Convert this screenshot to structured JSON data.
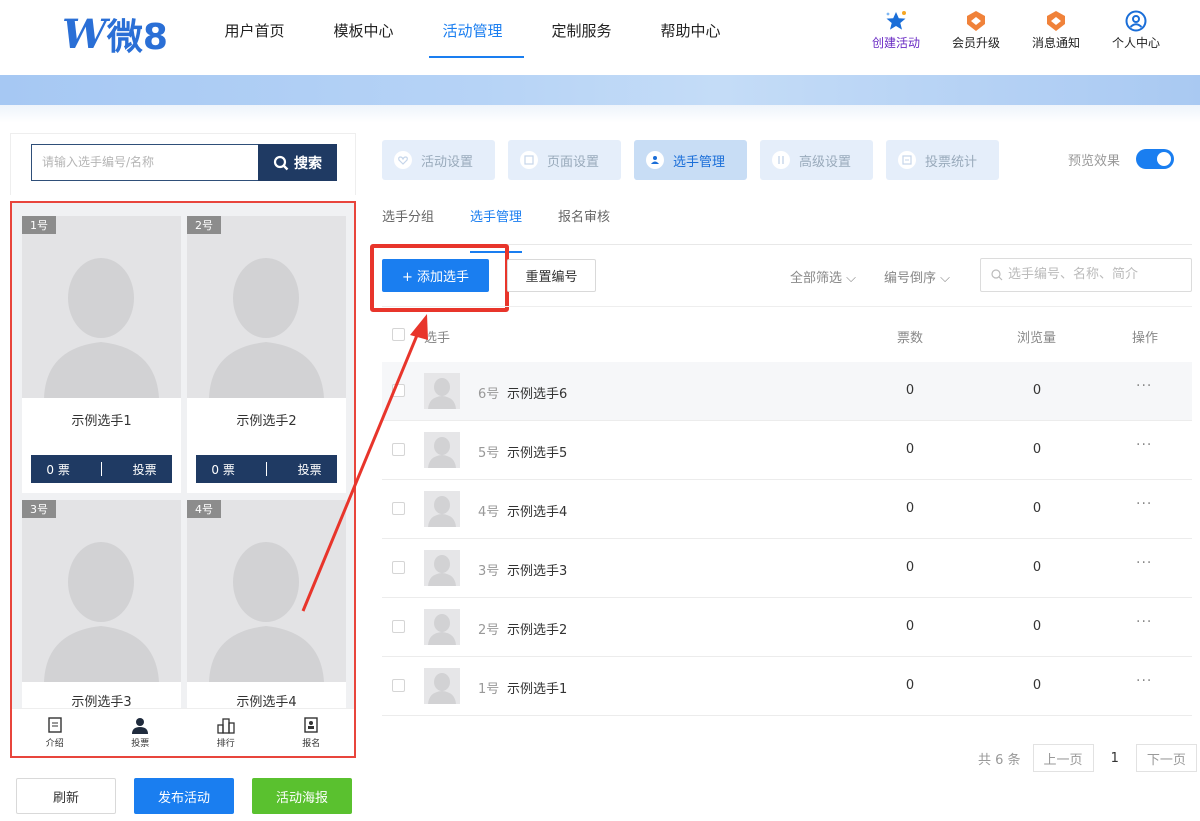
{
  "header": {
    "logo_text": "微8",
    "nav": [
      "用户首页",
      "模板中心",
      "活动管理",
      "定制服务",
      "帮助中心"
    ],
    "nav_active": "活动管理",
    "actions": [
      {
        "label": "创建活动",
        "icon": "star-icon"
      },
      {
        "label": "会员升级",
        "icon": "badge-icon"
      },
      {
        "label": "消息通知",
        "icon": "bell-badge-icon"
      },
      {
        "label": "个人中心",
        "icon": "user-circle-icon"
      }
    ]
  },
  "preview": {
    "search_placeholder": "请输入选手编号/名称",
    "search_button": "搜索",
    "cards": [
      {
        "num": "1号",
        "name": "示例选手1",
        "votes": "0 票",
        "vote_btn": "投票"
      },
      {
        "num": "2号",
        "name": "示例选手2",
        "votes": "0 票",
        "vote_btn": "投票"
      },
      {
        "num": "3号",
        "name": "示例选手3"
      },
      {
        "num": "4号",
        "name": "示例选手4"
      }
    ],
    "tabbar": [
      "介绍",
      "投票",
      "排行",
      "报名"
    ],
    "buttons": {
      "refresh": "刷新",
      "publish": "发布活动",
      "poster": "活动海报"
    }
  },
  "settings_tabs": [
    "活动设置",
    "页面设置",
    "选手管理",
    "高级设置",
    "投票统计"
  ],
  "settings_tab_active": "选手管理",
  "preview_toggle": {
    "label": "预览效果",
    "on": true
  },
  "subtabs": [
    "选手分组",
    "选手管理",
    "报名审核"
  ],
  "subtab_active": "选手管理",
  "toolbar": {
    "add": "+ 添加选手",
    "reset": "重置编号",
    "filter": "全部筛选",
    "sort": "编号倒序",
    "search_placeholder": "选手编号、名称、简介"
  },
  "table": {
    "headers": {
      "player": "选手",
      "votes": "票数",
      "views": "浏览量",
      "ops": "操作"
    },
    "rows": [
      {
        "num": "6号",
        "name": "示例选手6",
        "votes": "0",
        "views": "0"
      },
      {
        "num": "5号",
        "name": "示例选手5",
        "votes": "0",
        "views": "0"
      },
      {
        "num": "4号",
        "name": "示例选手4",
        "votes": "0",
        "views": "0"
      },
      {
        "num": "3号",
        "name": "示例选手3",
        "votes": "0",
        "views": "0"
      },
      {
        "num": "2号",
        "name": "示例选手2",
        "votes": "0",
        "views": "0"
      },
      {
        "num": "1号",
        "name": "示例选手1",
        "votes": "0",
        "views": "0"
      }
    ],
    "more": "···"
  },
  "pager": {
    "total": "共 6 条",
    "prev": "上一页",
    "current": "1",
    "next": "下一页"
  },
  "colors": {
    "primary": "#1a7ef0",
    "dark_navy": "#1f3a63",
    "highlight_red": "#e8352b",
    "green": "#5ac12f"
  }
}
